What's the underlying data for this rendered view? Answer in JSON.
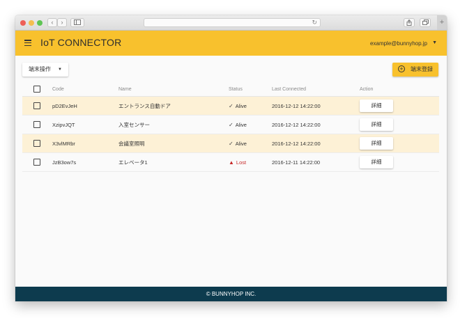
{
  "browser": {
    "back_icon": "chevron-left-icon",
    "forward_icon": "chevron-right-icon",
    "sidebar_icon": "sidebar-icon",
    "reload_icon": "reload-icon",
    "share_icon": "share-icon",
    "tabs_icon": "tabs-icon",
    "new_tab_icon": "plus-icon"
  },
  "appbar": {
    "title": "IoT CONNECTOR",
    "user_email": "example@bunnyhop.jp",
    "accent_color": "#f8c12d"
  },
  "toolbar": {
    "operation_label": "端末操作",
    "register_label": "端末登録"
  },
  "table": {
    "headers": {
      "code": "Code",
      "name": "Name",
      "status": "Status",
      "last_connected": "Last Connected",
      "action": "Action"
    },
    "rows": [
      {
        "code": "pD2EvJeH",
        "name": "エントランス自動ドア",
        "status": "Alive",
        "last_connected": "2016-12-12 14:22:00",
        "action": "詳細",
        "highlighted": true
      },
      {
        "code": "XzipvJQT",
        "name": "入室センサー",
        "status": "Alive",
        "last_connected": "2016-12-12 14:22:00",
        "action": "詳細",
        "highlighted": false
      },
      {
        "code": "X3vlMRbr",
        "name": "会議室照明",
        "status": "Alive",
        "last_connected": "2016-12-12 14:22:00",
        "action": "詳細",
        "highlighted": true
      },
      {
        "code": "JzB3ow7s",
        "name": "エレベータ1",
        "status": "Lost",
        "last_connected": "2016-12-11 14:22:00",
        "action": "詳細",
        "highlighted": false
      }
    ],
    "highlight_color": "#fdf1d6",
    "lost_color": "#c62828"
  },
  "footer": {
    "text": "© BUNNYHOP INC.",
    "color": "#0d3b4e"
  }
}
